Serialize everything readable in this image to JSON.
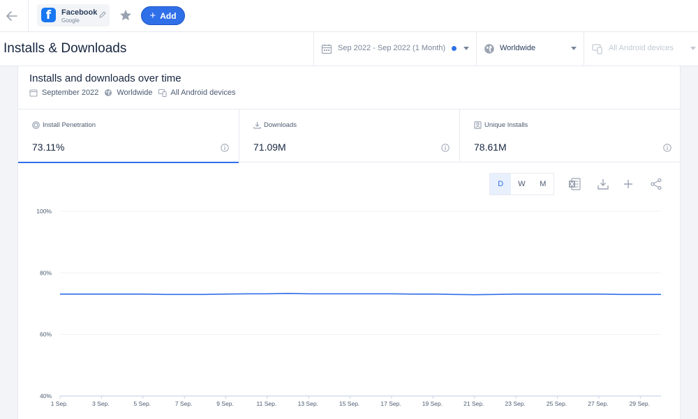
{
  "topbar": {
    "app_name": "Facebook",
    "app_store": "Google",
    "add_label": "Add",
    "app_icon_letter": "f",
    "brand_color": "#1877f2"
  },
  "header": {
    "page_title": "Installs & Downloads",
    "date_filter": "Sep 2022 - Sep 2022 (1 Month)",
    "geo_filter": "Worldwide",
    "device_filter": "All Android devices"
  },
  "card": {
    "title": "Installs and downloads over time",
    "meta": {
      "date": "September 2022",
      "geo": "Worldwide",
      "devices": "All Android devices"
    }
  },
  "kpis": [
    {
      "label": "Install Penetration",
      "value": "73.11%",
      "icon": "target-icon",
      "active": true
    },
    {
      "label": "Downloads",
      "value": "71.09M",
      "icon": "download-icon",
      "active": false
    },
    {
      "label": "Unique Installs",
      "value": "78.61M",
      "icon": "unique-installs-icon",
      "active": false
    }
  ],
  "granularity": [
    "D",
    "W",
    "M"
  ],
  "granularity_selected": "D",
  "toolbar_icons": [
    "excel-icon",
    "download-icon",
    "plus-icon",
    "share-icon"
  ],
  "accent_color": "#2f6fe8",
  "chart_data": {
    "type": "line",
    "title": "",
    "xlabel": "",
    "ylabel": "",
    "ylim": [
      40,
      100
    ],
    "y_ticks": [
      "40%",
      "60%",
      "80%",
      "100%"
    ],
    "y_tick_values": [
      40,
      60,
      80,
      100
    ],
    "x_tick_labels": [
      "1 Sep.",
      "3 Sep.",
      "5 Sep.",
      "7 Sep.",
      "9 Sep.",
      "11 Sep.",
      "13 Sep.",
      "15 Sep.",
      "17 Sep.",
      "19 Sep.",
      "21 Sep.",
      "23 Sep.",
      "25 Sep.",
      "27 Sep.",
      "29 Sep."
    ],
    "x_tick_days": [
      1,
      3,
      5,
      7,
      9,
      11,
      13,
      15,
      17,
      19,
      21,
      23,
      25,
      27,
      29
    ],
    "grid": true,
    "series": [
      {
        "color": "#2f6fe8",
        "x": [
          1,
          2,
          3,
          4,
          5,
          6,
          7,
          8,
          9,
          10,
          11,
          12,
          13,
          14,
          15,
          16,
          17,
          18,
          19,
          20,
          21,
          22,
          23,
          24,
          25,
          26,
          27,
          28,
          29,
          30
        ],
        "values": [
          73.1,
          73.1,
          73.1,
          73.1,
          73.1,
          73.0,
          73.0,
          73.0,
          73.1,
          73.2,
          73.2,
          73.3,
          73.2,
          73.2,
          73.2,
          73.2,
          73.2,
          73.1,
          73.1,
          73.0,
          72.9,
          73.0,
          73.1,
          73.1,
          73.1,
          73.1,
          73.1,
          73.0,
          73.0,
          73.0
        ]
      }
    ]
  }
}
